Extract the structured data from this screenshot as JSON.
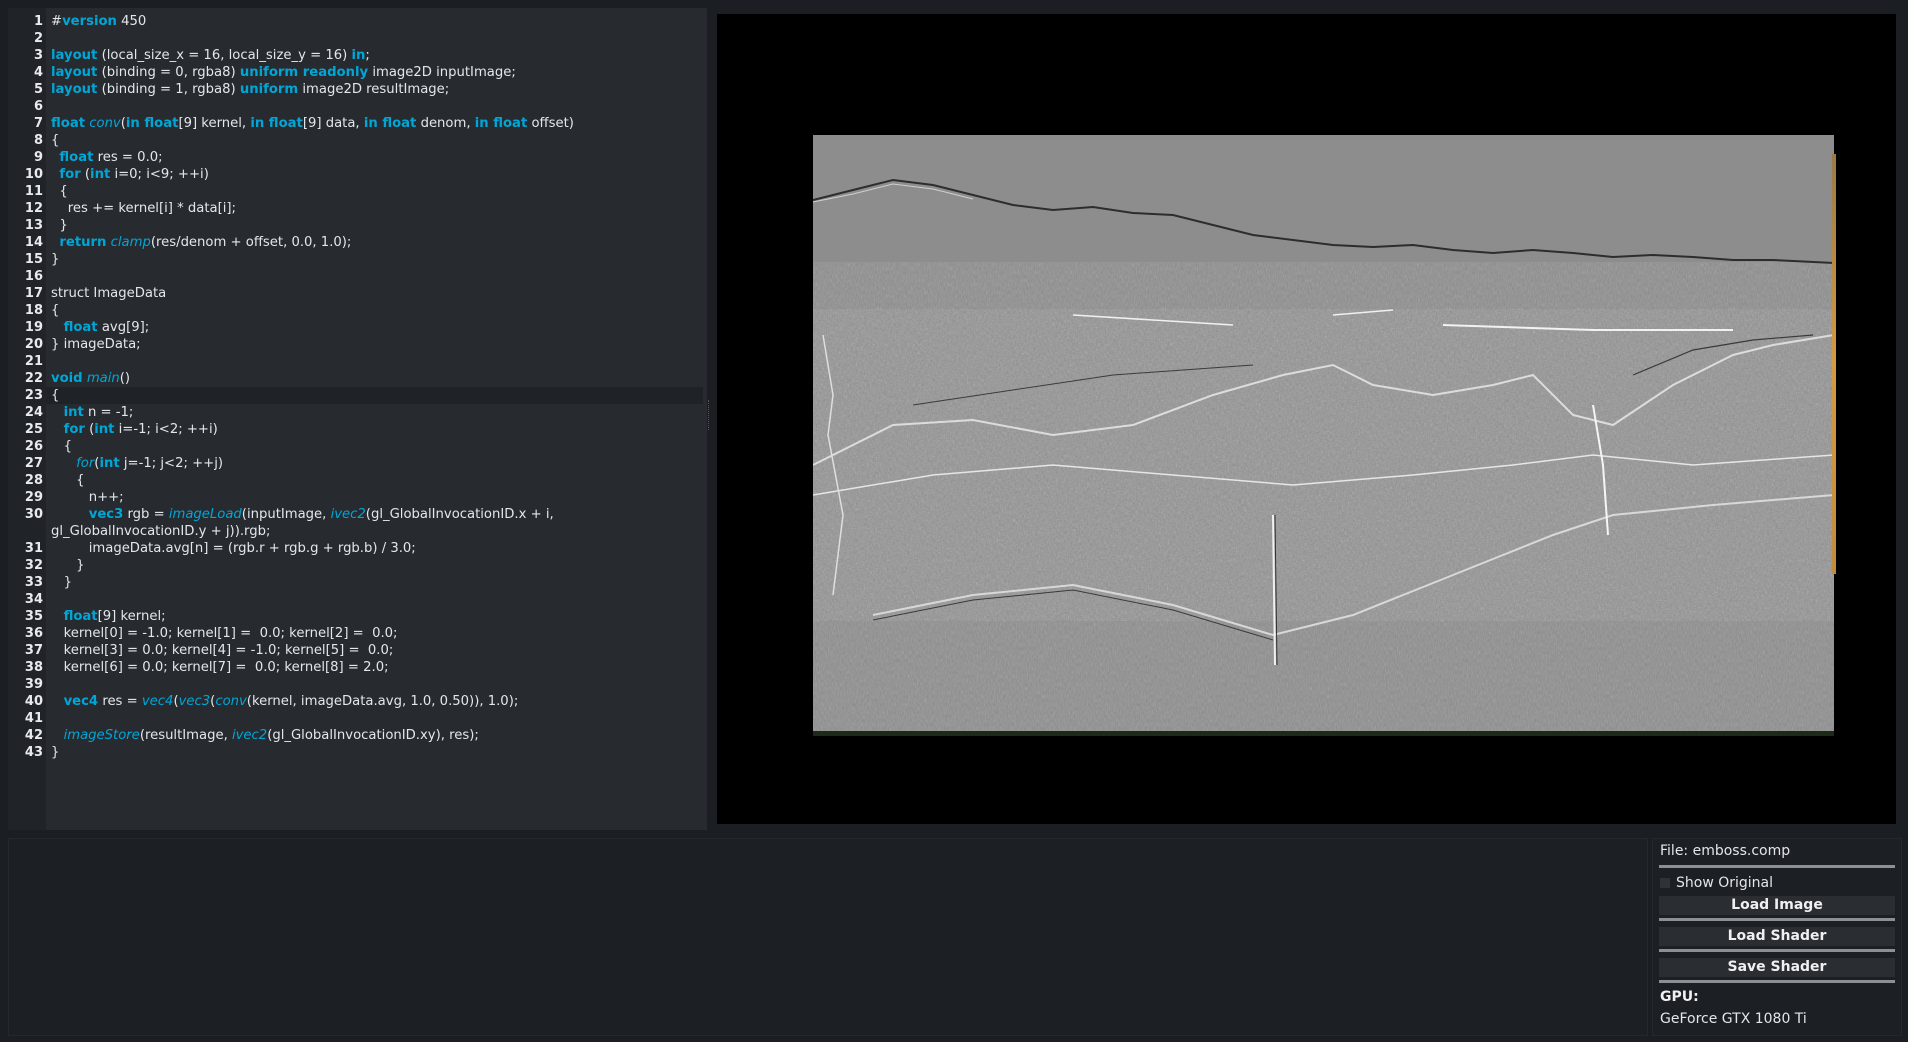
{
  "editor": {
    "lines": [
      [
        {
          "t": "#"
        },
        {
          "t": "version",
          "c": "kw"
        },
        {
          "t": " 450"
        }
      ],
      [],
      [
        {
          "t": "layout",
          "c": "kw"
        },
        {
          "t": " (local_size_x = 16, local_size_y = 16) "
        },
        {
          "t": "in",
          "c": "kw"
        },
        {
          "t": ";"
        }
      ],
      [
        {
          "t": "layout",
          "c": "kw"
        },
        {
          "t": " (binding = 0, rgba8) "
        },
        {
          "t": "uniform readonly",
          "c": "kw"
        },
        {
          "t": " image2D inputImage;"
        }
      ],
      [
        {
          "t": "layout",
          "c": "kw"
        },
        {
          "t": " (binding = 1, rgba8) "
        },
        {
          "t": "uniform",
          "c": "kw"
        },
        {
          "t": " image2D resultImage;"
        }
      ],
      [],
      [
        {
          "t": "float",
          "c": "kw"
        },
        {
          "t": " "
        },
        {
          "t": "conv",
          "c": "fn"
        },
        {
          "t": "("
        },
        {
          "t": "in float",
          "c": "kw"
        },
        {
          "t": "[9] kernel, "
        },
        {
          "t": "in float",
          "c": "kw"
        },
        {
          "t": "[9] data, "
        },
        {
          "t": "in float",
          "c": "kw"
        },
        {
          "t": " denom, "
        },
        {
          "t": "in float",
          "c": "kw"
        },
        {
          "t": " offset)"
        }
      ],
      [
        {
          "t": "{"
        }
      ],
      [
        {
          "t": "  "
        },
        {
          "t": "float",
          "c": "kw"
        },
        {
          "t": " res = 0.0;"
        }
      ],
      [
        {
          "t": "  "
        },
        {
          "t": "for",
          "c": "kw"
        },
        {
          "t": " ("
        },
        {
          "t": "int",
          "c": "kw"
        },
        {
          "t": " i=0; i<9; ++i)"
        }
      ],
      [
        {
          "t": "  {"
        }
      ],
      [
        {
          "t": "    res += kernel[i] * data[i];"
        }
      ],
      [
        {
          "t": "  }"
        }
      ],
      [
        {
          "t": "  "
        },
        {
          "t": "return",
          "c": "kw"
        },
        {
          "t": " "
        },
        {
          "t": "clamp",
          "c": "fn"
        },
        {
          "t": "(res/denom + offset, 0.0, 1.0);"
        }
      ],
      [
        {
          "t": "}"
        }
      ],
      [],
      [
        {
          "t": "struct ImageData"
        }
      ],
      [
        {
          "t": "{"
        }
      ],
      [
        {
          "t": "   "
        },
        {
          "t": "float",
          "c": "kw"
        },
        {
          "t": " avg[9];"
        }
      ],
      [
        {
          "t": "} imageData;"
        }
      ],
      [],
      [
        {
          "t": "void",
          "c": "kw"
        },
        {
          "t": " "
        },
        {
          "t": "main",
          "c": "fn"
        },
        {
          "t": "()"
        }
      ],
      [
        {
          "t": "{"
        }
      ],
      [
        {
          "t": "   "
        },
        {
          "t": "int",
          "c": "kw"
        },
        {
          "t": " n = -1;"
        }
      ],
      [
        {
          "t": "   "
        },
        {
          "t": "for",
          "c": "kw"
        },
        {
          "t": " ("
        },
        {
          "t": "int",
          "c": "kw"
        },
        {
          "t": " i=-1; i<2; ++i)"
        }
      ],
      [
        {
          "t": "   {"
        }
      ],
      [
        {
          "t": "      "
        },
        {
          "t": "for",
          "c": "fn"
        },
        {
          "t": "("
        },
        {
          "t": "int",
          "c": "kw"
        },
        {
          "t": " j=-1; j<2; ++j)"
        }
      ],
      [
        {
          "t": "      {"
        }
      ],
      [
        {
          "t": "         n++;"
        }
      ],
      [
        {
          "t": "         "
        },
        {
          "t": "vec3",
          "c": "kw"
        },
        {
          "t": " rgb = "
        },
        {
          "t": "imageLoad",
          "c": "fn"
        },
        {
          "t": "(inputImage, "
        },
        {
          "t": "ivec2",
          "c": "fn"
        },
        {
          "t": "(gl_GlobalInvocationID.x + i,"
        }
      ],
      [
        {
          "t": "gl_GlobalInvocationID.y + j)).rgb;"
        }
      ],
      [
        {
          "t": "         imageData.avg[n] = (rgb.r + rgb.g + rgb.b) / 3.0;"
        }
      ],
      [
        {
          "t": "      }"
        }
      ],
      [
        {
          "t": "   }"
        }
      ],
      [],
      [
        {
          "t": "   "
        },
        {
          "t": "float",
          "c": "kw"
        },
        {
          "t": "[9] kernel;"
        }
      ],
      [
        {
          "t": "   kernel[0] = -1.0; kernel[1] =  0.0; kernel[2] =  0.0;"
        }
      ],
      [
        {
          "t": "   kernel[3] = 0.0; kernel[4] = -1.0; kernel[5] =  0.0;"
        }
      ],
      [
        {
          "t": "   kernel[6] = 0.0; kernel[7] =  0.0; kernel[8] = 2.0;"
        }
      ],
      [],
      [
        {
          "t": "   "
        },
        {
          "t": "vec4",
          "c": "kw"
        },
        {
          "t": " res = "
        },
        {
          "t": "vec4",
          "c": "fn"
        },
        {
          "t": "("
        },
        {
          "t": "vec3",
          "c": "fn"
        },
        {
          "t": "("
        },
        {
          "t": "conv",
          "c": "fn"
        },
        {
          "t": "(kernel, imageData.avg, 1.0, 0.50)), 1.0);"
        }
      ],
      [],
      [
        {
          "t": "   "
        },
        {
          "t": "imageStore",
          "c": "fn"
        },
        {
          "t": "(resultImage, "
        },
        {
          "t": "ivec2",
          "c": "fn"
        },
        {
          "t": "(gl_GlobalInvocationID.xy), res);"
        }
      ],
      [
        {
          "t": "}"
        }
      ]
    ],
    "line_numbers": [
      "1",
      "2",
      "3",
      "4",
      "5",
      "6",
      "7",
      "8",
      "9",
      "10",
      "11",
      "12",
      "13",
      "14",
      "15",
      "16",
      "17",
      "18",
      "19",
      "20",
      "21",
      "22",
      "23",
      "24",
      "25",
      "26",
      "27",
      "28",
      "29",
      "30",
      "",
      "31",
      "32",
      "33",
      "34",
      "35",
      "36",
      "37",
      "38",
      "39",
      "40",
      "41",
      "42",
      "43"
    ],
    "current_line_index": 22
  },
  "panel": {
    "file_label": "File: emboss.comp",
    "show_original_label": "Show Original",
    "show_original_checked": false,
    "load_image_label": "Load Image",
    "load_shader_label": "Load Shader",
    "save_shader_label": "Save Shader",
    "gpu_title": "GPU:",
    "gpu_name": "GeForce GTX 1080 Ti"
  },
  "colors": {
    "keyword": "#00a6d6",
    "background": "#1b1e22",
    "editor_bg": "#272b30"
  }
}
